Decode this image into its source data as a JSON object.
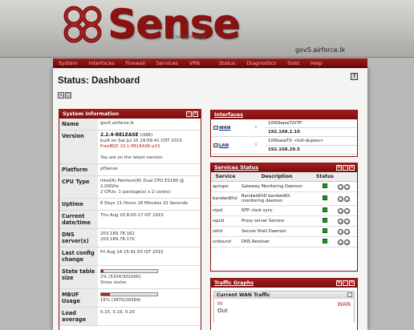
{
  "header": {
    "logo_text": "Sense",
    "tagline": "...Sense (tagline)",
    "hostname": "gov5.airforce.lk"
  },
  "nav": [
    "System",
    "Interfaces",
    "Firewall",
    "Services",
    "VPN",
    "Status",
    "Diagnostics",
    "Gold",
    "Help"
  ],
  "page": {
    "title": "Status: Dashboard",
    "help": "?"
  },
  "system_info": {
    "title": "System Information",
    "rows": {
      "name": {
        "label": "Name",
        "value": "gov5.airforce.lk"
      },
      "version": {
        "label": "Version",
        "release": "2.2.4-RELEASE",
        "arch": " (i386)",
        "built": "built on Sat Jul 25 19:56:41 CDT 2015",
        "freebsd": "FreeBSD 10.1-RELEASE-p15",
        "latest": "You are on the latest version."
      },
      "platform": {
        "label": "Platform",
        "value": "pfSense"
      },
      "cpu": {
        "label": "CPU Type",
        "line1": "Intel(R) Pentium(R) Dual CPU E2180 @ 2.00GHz",
        "line2": "2 CPUs: 1 package(s) x 2 core(s)"
      },
      "uptime": {
        "label": "Uptime",
        "value": "6 Days 21 Hours 18 Minutes 32 Seconds"
      },
      "datetime": {
        "label": "Current date/time",
        "value": "Thu Aug 20 8:05:17 IST 2015"
      },
      "dns": {
        "label": "DNS server(s)",
        "line1": "203.189.78.162",
        "line2": "203.189.78.170"
      },
      "last_config": {
        "label": "Last config change",
        "value": "Fri Aug 14 15:41:55 IST 2015"
      },
      "state_table": {
        "label": "State table size",
        "value": "2% (5334/302000)",
        "fraction": 0.02,
        "link": "Show states"
      },
      "mbuf": {
        "label": "MBUF Usage",
        "value": "15% (3870/26584)",
        "fraction": 0.15
      },
      "load": {
        "label": "Load average",
        "value": "0.15, 0.19, 0.20"
      }
    }
  },
  "interfaces": {
    "title": "Interfaces",
    "items": [
      {
        "name": "WAN",
        "media": "1000baseT/UTP",
        "ip": "192.168.2.10"
      },
      {
        "name": "LAN",
        "media": "100baseTX <full-duplex>",
        "ip": "192.168.20.5"
      }
    ]
  },
  "services": {
    "title": "Services Status",
    "headers": {
      "service": "Service",
      "description": "Description",
      "status": "Status"
    },
    "items": [
      {
        "name": "apinger",
        "desc": "Gateway Monitoring Daemon"
      },
      {
        "name": "bandwidthd",
        "desc": "BandwidthD bandwidth monitoring daemon"
      },
      {
        "name": "ntpd",
        "desc": "NTP clock sync"
      },
      {
        "name": "squid",
        "desc": "Proxy server Service"
      },
      {
        "name": "sshd",
        "desc": "Secure Shell Daemon"
      },
      {
        "name": "unbound",
        "desc": "DNS Resolver"
      }
    ]
  },
  "traffic": {
    "title": "Traffic Graphs",
    "sub_title": "Current WAN Traffic",
    "in_label": "In",
    "out_label": "Out",
    "iface_label": "WAN"
  }
}
